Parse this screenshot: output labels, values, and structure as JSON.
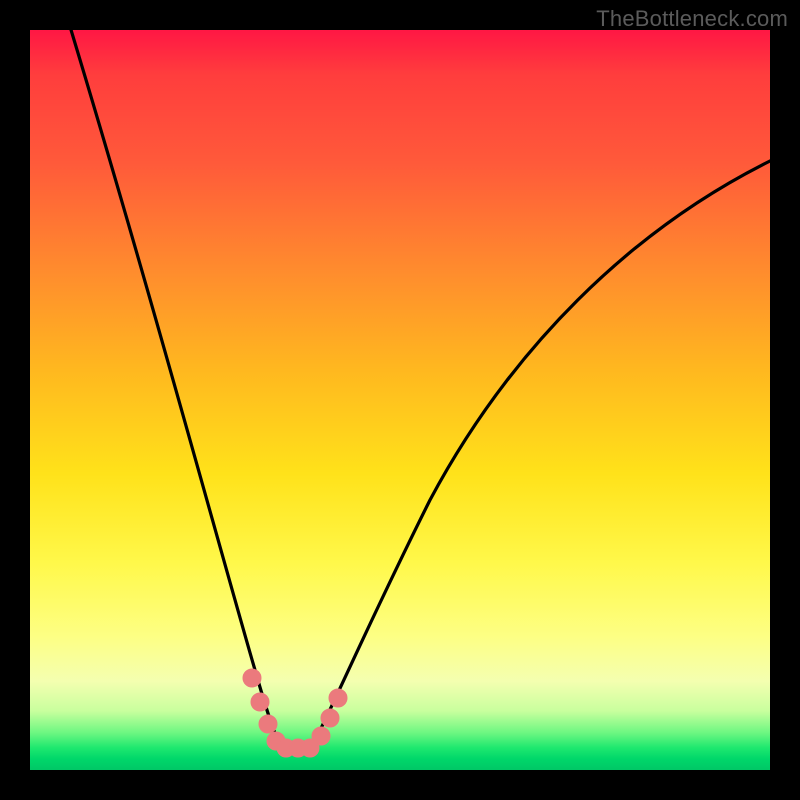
{
  "watermark": "TheBottleneck.com",
  "chart_data": {
    "type": "line",
    "title": "",
    "xlabel": "",
    "ylabel": "",
    "xlim": [
      0,
      100
    ],
    "ylim": [
      0,
      100
    ],
    "series": [
      {
        "name": "bottleneck-curve",
        "x": [
          0,
          5,
          10,
          15,
          20,
          25,
          28,
          30,
          32,
          34,
          36,
          40,
          45,
          50,
          55,
          60,
          65,
          70,
          75,
          80,
          85,
          90,
          95,
          100
        ],
        "y": [
          100,
          84,
          68,
          53,
          38,
          22,
          12,
          6,
          2,
          0.5,
          0.5,
          2,
          8,
          16,
          24,
          32,
          39,
          46,
          52,
          58,
          63,
          68,
          72,
          76
        ]
      }
    ],
    "min_point": {
      "x": 33,
      "y": 0
    },
    "marker_segment": {
      "x": [
        27,
        29,
        31,
        33,
        35,
        37
      ],
      "y": [
        8,
        3,
        0.8,
        0.5,
        0.8,
        3
      ]
    },
    "gradient_stops": [
      {
        "pos": 0,
        "color": "#ff1744"
      },
      {
        "pos": 50,
        "color": "#ffd61a"
      },
      {
        "pos": 88,
        "color": "#f4ffb0"
      },
      {
        "pos": 100,
        "color": "#00c766"
      }
    ]
  }
}
